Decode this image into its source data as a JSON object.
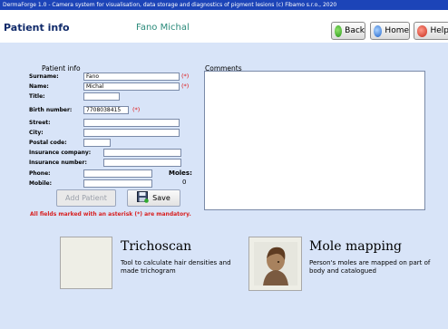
{
  "window": {
    "title": "DermaForge 1.0 - Camera system for visualisation, data storage and diagnostics of pigment lesions (c) Fibamo s.r.o., 2020"
  },
  "header": {
    "page_title": "Patient info",
    "patient_name": "Fano Michal"
  },
  "toolbar": {
    "back_label": "Back",
    "home_label": "Home",
    "help_label": "Help"
  },
  "form": {
    "group_label": "Patient info",
    "surname": {
      "label": "Surname:",
      "value": "Fano",
      "required_mark": "(*)"
    },
    "name": {
      "label": "Name:",
      "value": "Michal",
      "required_mark": "(*)"
    },
    "title": {
      "label": "Title:",
      "value": ""
    },
    "birth_number": {
      "label": "Birth number:",
      "value": "7708038415",
      "required_mark": "(*)"
    },
    "street": {
      "label": "Street:",
      "value": ""
    },
    "city": {
      "label": "City:",
      "value": ""
    },
    "postal_code": {
      "label": "Postal code:",
      "value": ""
    },
    "insurance_company": {
      "label": "Insurance company:",
      "value": ""
    },
    "insurance_number": {
      "label": "Insurance number:",
      "value": ""
    },
    "phone": {
      "label": "Phone:",
      "value": ""
    },
    "mobile": {
      "label": "Mobile:",
      "value": ""
    },
    "moles_label": "Moles:",
    "moles_count": "0",
    "add_patient_label": "Add Patient",
    "save_label": "Save",
    "mandatory_note": "All fields marked with an asterisk (*) are mandatory."
  },
  "comments": {
    "label": "Comments",
    "value": ""
  },
  "modules": [
    {
      "title": "Trichoscan",
      "description": "Tool to calculate hair densities and made trichogram"
    },
    {
      "title": "Mole mapping",
      "description": "Person's moles are mapped on part of body and catalogued"
    }
  ]
}
